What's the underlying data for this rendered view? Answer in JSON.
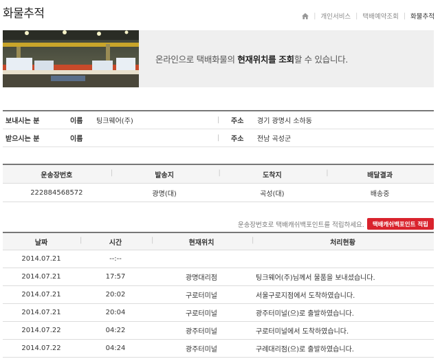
{
  "page": {
    "title": "화물추적"
  },
  "breadcrumb": {
    "home_icon": "home-icon",
    "items": [
      "개인서비스",
      "택배예약조회",
      "화물추적"
    ]
  },
  "banner": {
    "text_before": "온라인으로 택배화물의 ",
    "text_bold": "현재위치를 조회",
    "text_after": "할 수 있습니다."
  },
  "party": {
    "sender": {
      "label": "보내시는 분",
      "name_key": "이름",
      "name": "팅크웨어(주)",
      "addr_key": "주소",
      "addr": "경기 광명시 소하동"
    },
    "receiver": {
      "label": "받으시는 분",
      "name_key": "이름",
      "name": "",
      "addr_key": "주소",
      "addr": "전남 곡성군"
    }
  },
  "waybill": {
    "headers": [
      "운송장번호",
      "발송지",
      "도착지",
      "배달결과"
    ],
    "row": [
      "222884568572",
      "광명(대)",
      "곡성(대)",
      "배송중"
    ]
  },
  "points": {
    "text": "운송장번호로 택배캐쉬백포인트를 적립하세요.",
    "button": "택배캐쉬백포인트 적립"
  },
  "history": {
    "headers": [
      "날짜",
      "시간",
      "현재위치",
      "처리현황"
    ],
    "rows": [
      [
        "2014.07.21",
        "--:--",
        "",
        ""
      ],
      [
        "2014.07.21",
        "17:57",
        "광명대리점",
        "팅크웨어(주)님께서 물품을 보내셨습니다."
      ],
      [
        "2014.07.21",
        "20:02",
        "구로터미널",
        "서울구로지점에서 도착하였습니다."
      ],
      [
        "2014.07.21",
        "20:04",
        "구로터미널",
        "광주터미널(으)로 출발하였습니다."
      ],
      [
        "2014.07.22",
        "04:22",
        "광주터미널",
        "구로터미널에서 도착하였습니다."
      ],
      [
        "2014.07.22",
        "04:24",
        "광주터미널",
        "구례대리점(으)로 출발하였습니다."
      ]
    ]
  },
  "colors": {
    "accent_red": "#d9232d",
    "banner_bg": "#efefef",
    "header_bg": "#f5f5f5"
  }
}
